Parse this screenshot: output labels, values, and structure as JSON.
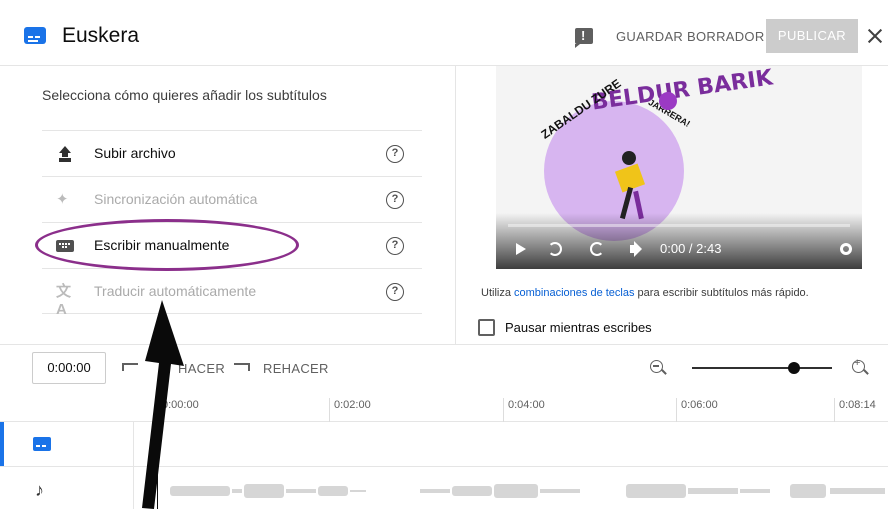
{
  "header": {
    "title": "Euskera",
    "save_draft": "GUARDAR BORRADOR",
    "publish": "PUBLICAR"
  },
  "left_pane": {
    "prompt": "Selecciona cómo quieres añadir los subtítulos",
    "options": [
      {
        "label": "Subir archivo",
        "enabled": true,
        "icon": "upload-icon"
      },
      {
        "label": "Sincronización automática",
        "enabled": false,
        "icon": "sparkle-icon"
      },
      {
        "label": "Escribir manualmente",
        "enabled": true,
        "icon": "keyboard-icon"
      },
      {
        "label": "Traducir automáticamente",
        "enabled": false,
        "icon": "translate-icon"
      }
    ],
    "help_glyph": "?"
  },
  "video": {
    "time": "0:00 / 2:43",
    "art_title": "BELDUR BARIK",
    "art_text_left": "ZABALDU ZURE",
    "art_text_right": "JARRERA!"
  },
  "hint": {
    "before": "Utiliza",
    "link": "combinaciones de teclas",
    "after": "para escribir subtítulos más rápido."
  },
  "pause_while_typing": "Pausar mientras escribes",
  "toolbar": {
    "timecode": "0:00:00",
    "undo": "HACER",
    "redo": "REHACER"
  },
  "ruler": {
    "ticks": [
      "0:00:00",
      "0:02:00",
      "0:04:00",
      "0:06:00",
      "0:08:14"
    ]
  },
  "colors": {
    "accent": "#1a73e8",
    "annotation": "#8b2f8b",
    "link": "#065fd4"
  }
}
